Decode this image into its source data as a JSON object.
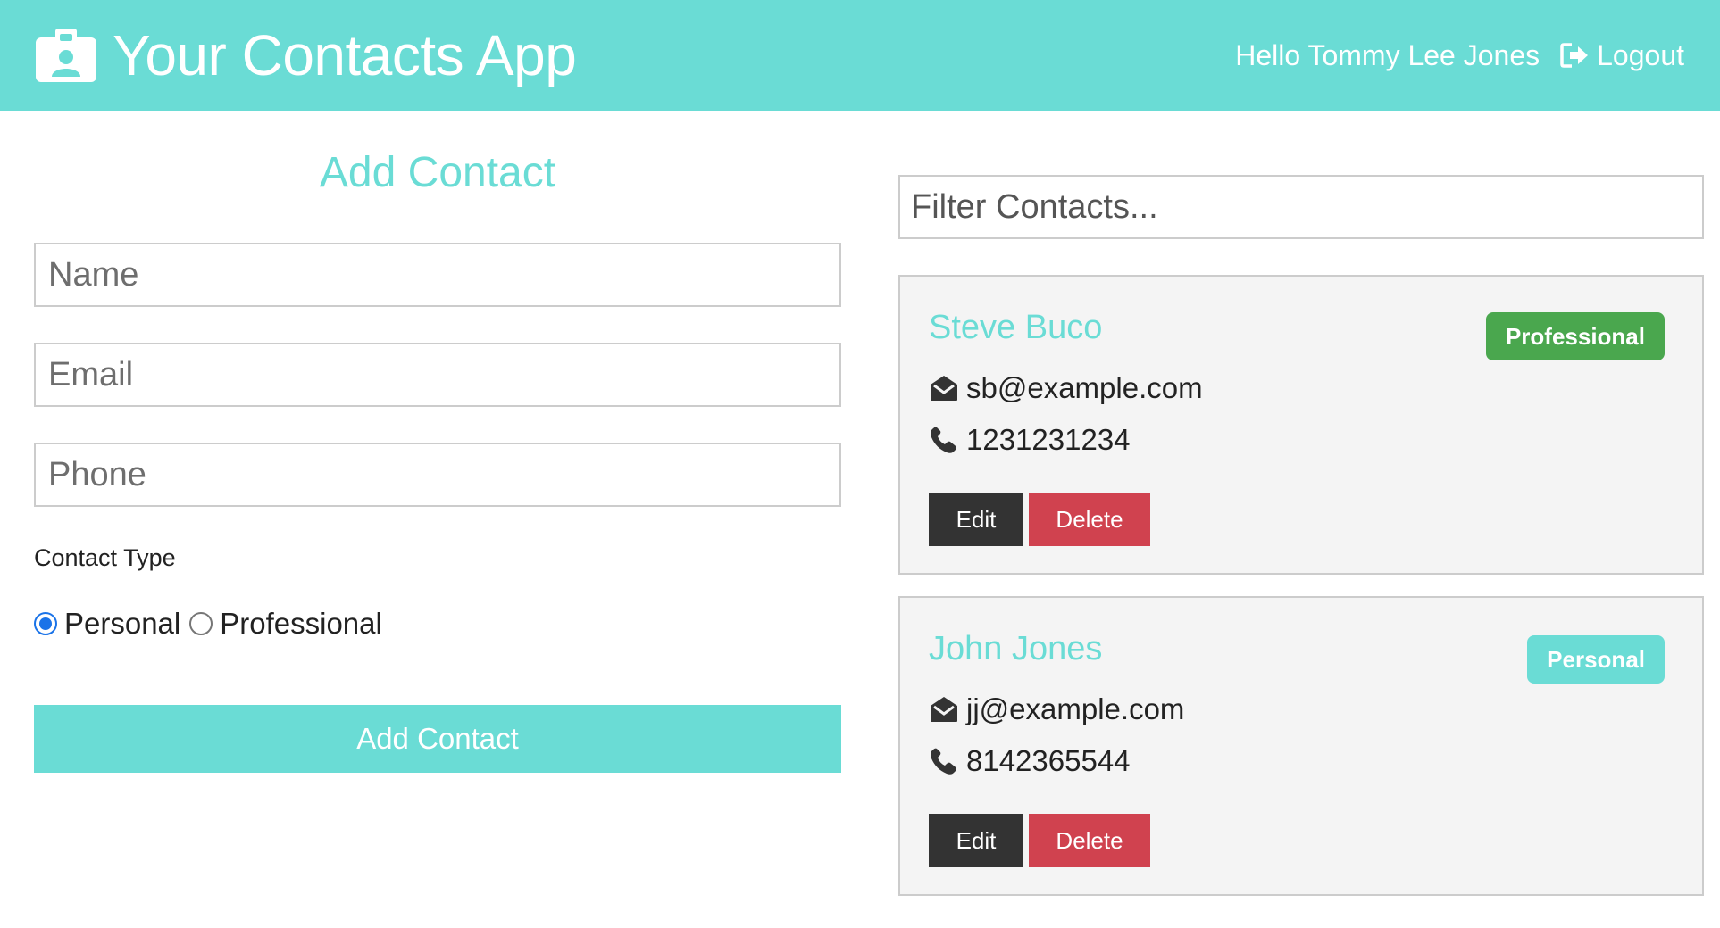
{
  "navbar": {
    "title": "Your Contacts App",
    "icon": "id-badge-icon",
    "greeting": "Hello Tommy Lee Jones",
    "logout_label": "Logout",
    "logout_icon": "sign-out-icon",
    "background": "#6adcd5"
  },
  "form": {
    "title": "Add Contact",
    "name_placeholder": "Name",
    "email_placeholder": "Email",
    "phone_placeholder": "Phone",
    "type_label": "Contact Type",
    "options": [
      {
        "label": "Personal",
        "checked": true
      },
      {
        "label": "Professional",
        "checked": false
      }
    ],
    "submit_label": "Add Contact"
  },
  "filter": {
    "placeholder": "Filter Contacts..."
  },
  "contacts": [
    {
      "name": "Steve Buco",
      "email": "sb@example.com",
      "phone": "1231231234",
      "type": "Professional",
      "badge_color": "#4aa74e",
      "edit_label": "Edit",
      "delete_label": "Delete"
    },
    {
      "name": "John Jones",
      "email": "jj@example.com",
      "phone": "8142365544",
      "type": "Personal",
      "badge_color": "#6adcd5",
      "edit_label": "Edit",
      "delete_label": "Delete"
    }
  ],
  "colors": {
    "accent": "#6adcd5",
    "dark": "#333333",
    "danger": "#d0424f",
    "success": "#4aa74e",
    "card_bg": "#f4f4f4"
  }
}
